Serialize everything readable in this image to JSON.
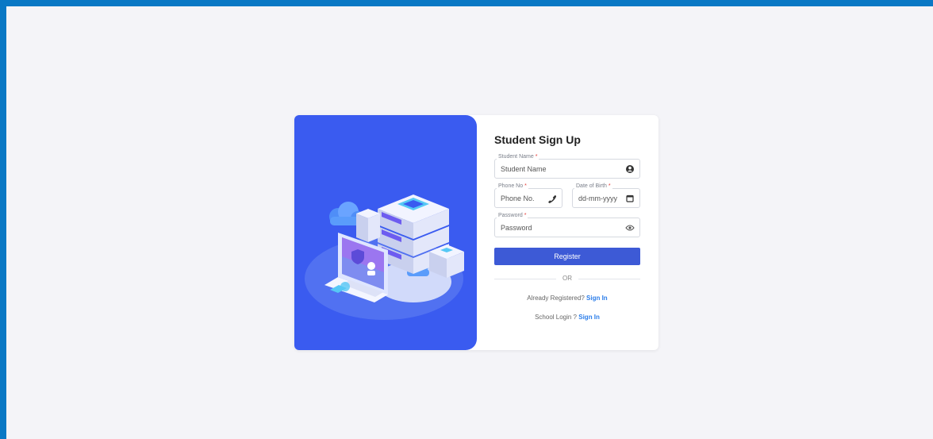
{
  "form": {
    "title": "Student Sign Up",
    "student_name": {
      "label": "Student Name",
      "required_mark": "*",
      "placeholder": "Student Name",
      "icon": "user-circle-icon"
    },
    "phone": {
      "label": "Phone No",
      "required_mark": "*",
      "placeholder": "Phone No.",
      "icon": "phone-icon"
    },
    "dob": {
      "label": "Date of Birth",
      "required_mark": "*",
      "placeholder": "dd-mm-yyyy",
      "icon": "calendar-icon"
    },
    "password": {
      "label": "Password",
      "required_mark": "*",
      "placeholder": "Password",
      "icon": "eye-icon"
    },
    "register_label": "Register",
    "or_label": "OR",
    "already_registered_text": "Already Registered?",
    "already_registered_link": "Sign In",
    "school_login_text": "School Login ?",
    "school_login_link": "Sign In"
  },
  "colors": {
    "accent": "#3d5ad6",
    "illustration_bg": "#3a5bf0",
    "link": "#2b7de9",
    "required": "#e53935",
    "frame_border": "#0a78c5",
    "page_bg": "#f4f4f8"
  }
}
